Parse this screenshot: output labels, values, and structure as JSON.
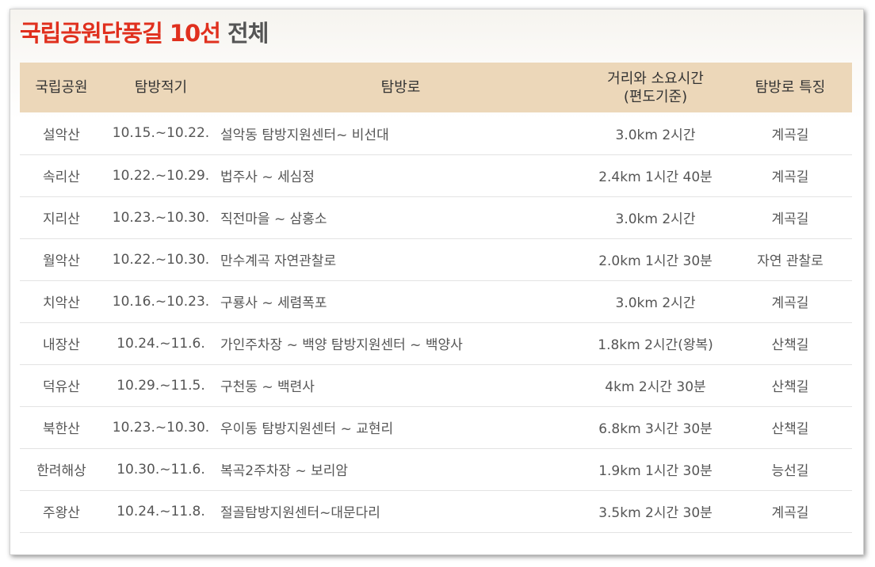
{
  "title_highlight": "국립공원단풍길 10선",
  "title_rest": "전체",
  "table": {
    "headers": {
      "park": "국립공원",
      "period": "탐방적기",
      "route": "탐방로",
      "distance_line1": "거리와 소요시간",
      "distance_line2": "(편도기준)",
      "feature": "탐방로 특징"
    },
    "rows": [
      {
        "park": "설악산",
        "period": "10.15.~10.22.",
        "route": "설악동 탐방지원센터~ 비선대",
        "distance": "3.0km 2시간",
        "feature": "계곡길"
      },
      {
        "park": "속리산",
        "period": "10.22.~10.29.",
        "route": "법주사 ~ 세심정",
        "distance": "2.4km 1시간 40분",
        "feature": "계곡길"
      },
      {
        "park": "지리산",
        "period": "10.23.~10.30.",
        "route": "직전마을 ~ 삼홍소",
        "distance": "3.0km 2시간",
        "feature": "계곡길"
      },
      {
        "park": "월악산",
        "period": "10.22.~10.30.",
        "route": "만수계곡 자연관찰로",
        "distance": "2.0km 1시간 30분",
        "feature": "자연 관찰로"
      },
      {
        "park": "치악산",
        "period": "10.16.~10.23.",
        "route": "구룡사 ~ 세렴폭포",
        "distance": "3.0km 2시간",
        "feature": "계곡길"
      },
      {
        "park": "내장산",
        "period": "10.24.~11.6.",
        "route": "가인주차장 ~ 백양 탐방지원센터 ~ 백양사",
        "distance": "1.8km 2시간(왕복)",
        "feature": "산책길"
      },
      {
        "park": "덕유산",
        "period": "10.29.~11.5.",
        "route": "구천동 ~ 백련사",
        "distance": "4km 2시간 30분",
        "feature": "산책길"
      },
      {
        "park": "북한산",
        "period": "10.23.~10.30.",
        "route": "우이동 탐방지원센터 ~ 교현리",
        "distance": "6.8km 3시간 30분",
        "feature": "산책길"
      },
      {
        "park": "한려해상",
        "period": "10.30.~11.6.",
        "route": "복곡2주차장 ~ 보리암",
        "distance": "1.9km 1시간 30분",
        "feature": "능선길"
      },
      {
        "park": "주왕산",
        "period": "10.24.~11.8.",
        "route": "절골탐방지원센터~대문다리",
        "distance": "3.5km 2시간 30분",
        "feature": "계곡길"
      }
    ]
  }
}
